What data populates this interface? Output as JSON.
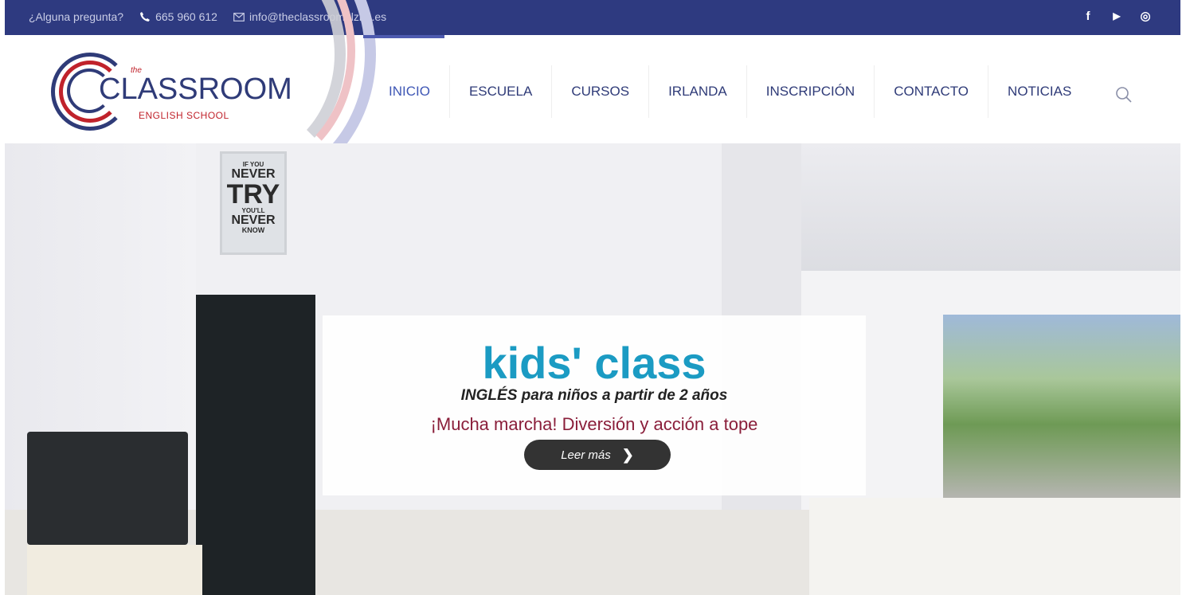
{
  "topbar": {
    "question": "¿Alguna pregunta?",
    "phone": "665 960 612",
    "email": "info@theclassroomalzira.es",
    "social_icons": [
      "facebook-icon",
      "youtube-icon",
      "instagram-icon"
    ],
    "social_glyphs": {
      "facebook": "f",
      "youtube": "▶",
      "instagram": "◎"
    },
    "bg_color": "#2e3a80"
  },
  "logo": {
    "the": "the",
    "word": "CLASSROOM",
    "school": "ENGLISH SCHOOL"
  },
  "nav": {
    "items": [
      {
        "label": "INICIO",
        "active": true
      },
      {
        "label": "ESCUELA"
      },
      {
        "label": "CURSOS"
      },
      {
        "label": "IRLANDA"
      },
      {
        "label": "INSCRIPCIÓN"
      },
      {
        "label": "CONTACTO"
      },
      {
        "label": "NOTICIAS"
      }
    ],
    "search_icon": "search-icon",
    "text_color": "#2f3b78"
  },
  "hero": {
    "title": "kids' class",
    "subtitle": "INGLÉS para niños a partir de 2 años",
    "tagline": "¡Mucha marcha! Diversión y acción a tope",
    "button_label": "Leer más",
    "title_color": "#1b9bc3",
    "tagline_color": "#8a1e3a"
  },
  "poster": {
    "lines": [
      "IF YOU",
      "NEVER",
      "TRY",
      "YOU'LL",
      "NEVER",
      "KNOW"
    ]
  }
}
